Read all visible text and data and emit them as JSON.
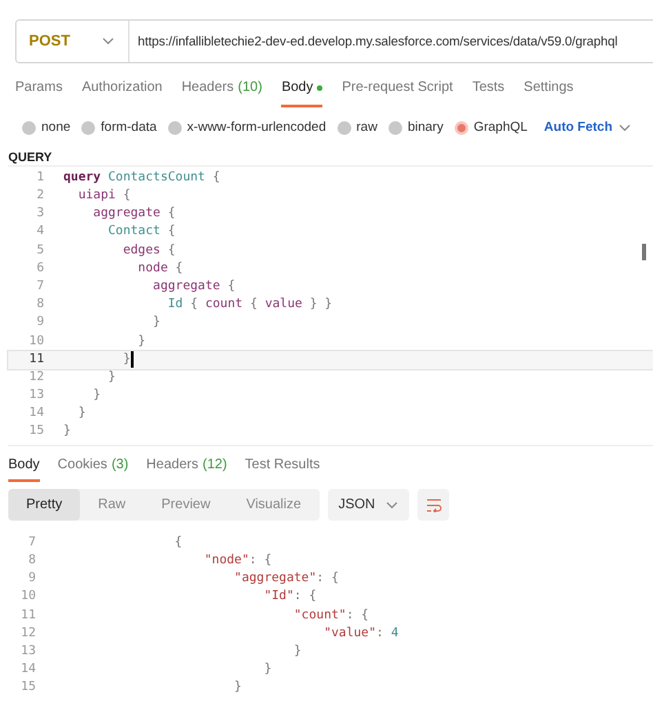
{
  "request": {
    "method": "POST",
    "url": "https://infallibletechie2-dev-ed.develop.my.salesforce.com/services/data/v59.0/graphql"
  },
  "request_tabs": [
    {
      "label": "Params",
      "dot": false,
      "selected": false
    },
    {
      "label": "Authorization",
      "dot": false,
      "selected": false
    },
    {
      "label": "Headers",
      "count": "(10)",
      "dot": false,
      "selected": false
    },
    {
      "label": "Body",
      "dot": true,
      "selected": true
    },
    {
      "label": "Pre-request Script",
      "dot": false,
      "selected": false
    },
    {
      "label": "Tests",
      "dot": false,
      "selected": false
    },
    {
      "label": "Settings",
      "dot": false,
      "selected": false
    }
  ],
  "body_types": [
    {
      "label": "none",
      "selected": false
    },
    {
      "label": "form-data",
      "selected": false
    },
    {
      "label": "x-www-form-urlencoded",
      "selected": false
    },
    {
      "label": "raw",
      "selected": false
    },
    {
      "label": "binary",
      "selected": false
    },
    {
      "label": "GraphQL",
      "selected": true
    }
  ],
  "auto_fetch": "Auto Fetch",
  "query_label": "QUERY",
  "query_lines": [
    {
      "number": "1",
      "current": false,
      "tokens": [
        {
          "kind": "keyword",
          "text": "query"
        },
        {
          "kind": "type",
          "text": " ContactsCount"
        },
        {
          "kind": "punct",
          "text": " {"
        }
      ]
    },
    {
      "number": "2",
      "current": false,
      "tokens": [
        {
          "kind": "field",
          "text": "  uiapi"
        },
        {
          "kind": "punct",
          "text": " {"
        }
      ]
    },
    {
      "number": "3",
      "current": false,
      "tokens": [
        {
          "kind": "field",
          "text": "    aggregate"
        },
        {
          "kind": "punct",
          "text": " {"
        }
      ]
    },
    {
      "number": "4",
      "current": false,
      "tokens": [
        {
          "kind": "type",
          "text": "      Contact"
        },
        {
          "kind": "punct",
          "text": " {"
        }
      ]
    },
    {
      "number": "5",
      "current": false,
      "tokens": [
        {
          "kind": "field",
          "text": "        edges"
        },
        {
          "kind": "punct",
          "text": " {"
        }
      ]
    },
    {
      "number": "6",
      "current": false,
      "tokens": [
        {
          "kind": "field",
          "text": "          node"
        },
        {
          "kind": "punct",
          "text": " {"
        }
      ]
    },
    {
      "number": "7",
      "current": false,
      "tokens": [
        {
          "kind": "field",
          "text": "            aggregate"
        },
        {
          "kind": "punct",
          "text": " {"
        }
      ]
    },
    {
      "number": "8",
      "current": false,
      "tokens": [
        {
          "kind": "type",
          "text": "              Id"
        },
        {
          "kind": "punct",
          "text": " { "
        },
        {
          "kind": "field",
          "text": "count"
        },
        {
          "kind": "punct",
          "text": " { "
        },
        {
          "kind": "field",
          "text": "value"
        },
        {
          "kind": "punct",
          "text": " } }"
        }
      ]
    },
    {
      "number": "9",
      "current": false,
      "tokens": [
        {
          "kind": "punct",
          "text": "            }"
        }
      ]
    },
    {
      "number": "10",
      "current": false,
      "tokens": [
        {
          "kind": "punct",
          "text": "          }"
        }
      ]
    },
    {
      "number": "11",
      "current": true,
      "tokens": [
        {
          "kind": "punct",
          "text": "        }"
        }
      ]
    },
    {
      "number": "12",
      "current": false,
      "tokens": [
        {
          "kind": "punct",
          "text": "      }"
        }
      ]
    },
    {
      "number": "13",
      "current": false,
      "tokens": [
        {
          "kind": "punct",
          "text": "    }"
        }
      ]
    },
    {
      "number": "14",
      "current": false,
      "tokens": [
        {
          "kind": "punct",
          "text": "  }"
        }
      ]
    },
    {
      "number": "15",
      "current": false,
      "tokens": [
        {
          "kind": "punct",
          "text": "}"
        }
      ]
    }
  ],
  "response_tabs": [
    {
      "label": "Body",
      "selected": true
    },
    {
      "label": "Cookies",
      "count": "(3)",
      "selected": false
    },
    {
      "label": "Headers",
      "count": "(12)",
      "selected": false
    },
    {
      "label": "Test Results",
      "selected": false
    }
  ],
  "view_modes": [
    {
      "label": "Pretty",
      "selected": true
    },
    {
      "label": "Raw",
      "selected": false
    },
    {
      "label": "Preview",
      "selected": false
    },
    {
      "label": "Visualize",
      "selected": false
    }
  ],
  "format": "JSON",
  "response_lines": [
    {
      "number": "7",
      "tokens": [
        {
          "kind": "punct",
          "text": "                {"
        }
      ]
    },
    {
      "number": "8",
      "tokens": [
        {
          "kind": "key",
          "text": "                    \"node\""
        },
        {
          "kind": "punct",
          "text": ": {"
        }
      ]
    },
    {
      "number": "9",
      "tokens": [
        {
          "kind": "key",
          "text": "                        \"aggregate\""
        },
        {
          "kind": "punct",
          "text": ": {"
        }
      ]
    },
    {
      "number": "10",
      "tokens": [
        {
          "kind": "key",
          "text": "                            \"Id\""
        },
        {
          "kind": "punct",
          "text": ": {"
        }
      ]
    },
    {
      "number": "11",
      "tokens": [
        {
          "kind": "key",
          "text": "                                \"count\""
        },
        {
          "kind": "punct",
          "text": ": {"
        }
      ]
    },
    {
      "number": "12",
      "tokens": [
        {
          "kind": "key",
          "text": "                                    \"value\""
        },
        {
          "kind": "punct",
          "text": ": "
        },
        {
          "kind": "number",
          "text": "4"
        }
      ]
    },
    {
      "number": "13",
      "tokens": [
        {
          "kind": "punct",
          "text": "                                }"
        }
      ]
    },
    {
      "number": "14",
      "tokens": [
        {
          "kind": "punct",
          "text": "                            }"
        }
      ]
    },
    {
      "number": "15",
      "tokens": [
        {
          "kind": "punct",
          "text": "                        }"
        }
      ]
    }
  ]
}
